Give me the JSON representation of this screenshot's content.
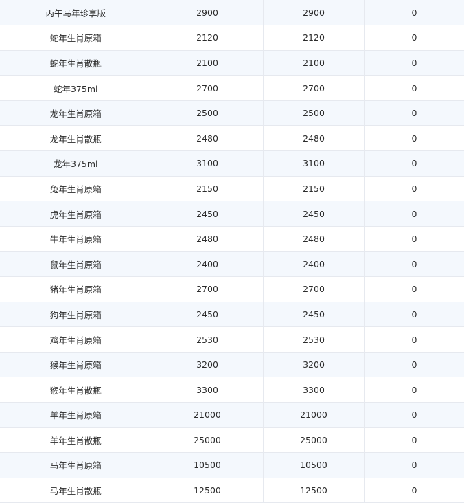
{
  "table": {
    "rows": [
      [
        "丙午马年珍享版",
        "2900",
        "2900",
        "0"
      ],
      [
        "蛇年生肖原箱",
        "2120",
        "2120",
        "0"
      ],
      [
        "蛇年生肖散瓶",
        "2100",
        "2100",
        "0"
      ],
      [
        "蛇年375ml",
        "2700",
        "2700",
        "0"
      ],
      [
        "龙年生肖原箱",
        "2500",
        "2500",
        "0"
      ],
      [
        "龙年生肖散瓶",
        "2480",
        "2480",
        "0"
      ],
      [
        "龙年375ml",
        "3100",
        "3100",
        "0"
      ],
      [
        "兔年生肖原箱",
        "2150",
        "2150",
        "0"
      ],
      [
        "虎年生肖原箱",
        "2450",
        "2450",
        "0"
      ],
      [
        "牛年生肖原箱",
        "2480",
        "2480",
        "0"
      ],
      [
        "鼠年生肖原箱",
        "2400",
        "2400",
        "0"
      ],
      [
        "猪年生肖原箱",
        "2700",
        "2700",
        "0"
      ],
      [
        "狗年生肖原箱",
        "2450",
        "2450",
        "0"
      ],
      [
        "鸡年生肖原箱",
        "2530",
        "2530",
        "0"
      ],
      [
        "猴年生肖原箱",
        "3200",
        "3200",
        "0"
      ],
      [
        "猴年生肖散瓶",
        "3300",
        "3300",
        "0"
      ],
      [
        "羊年生肖原箱",
        "21000",
        "21000",
        "0"
      ],
      [
        "羊年生肖散瓶",
        "25000",
        "25000",
        "0"
      ],
      [
        "马年生肖原箱",
        "10500",
        "10500",
        "0"
      ],
      [
        "马年生肖散瓶",
        "12500",
        "12500",
        "0"
      ]
    ]
  },
  "colors": {
    "row_stripe": "#f4f8fd",
    "row_plain": "#ffffff",
    "border": "#e6e9ef",
    "text": "#2b2b2b"
  }
}
